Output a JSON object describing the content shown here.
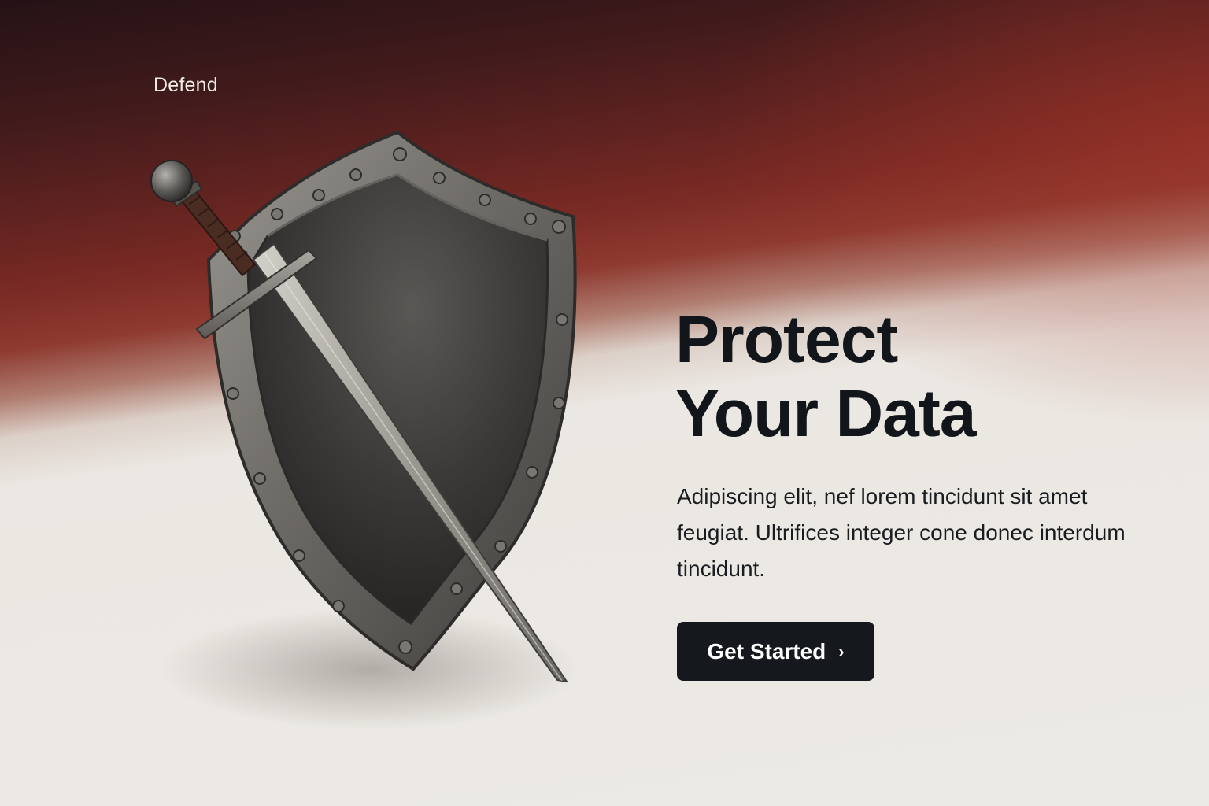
{
  "brand": {
    "name": "Defend"
  },
  "hero": {
    "title_line1": "Protect",
    "title_line2": "Your Data",
    "description": "Adipiscing elit, nef lorem tincidunt sit amet feugiat. Ultrifices integer cone donec interdum tincidunt.",
    "cta_label": "Get Started",
    "cta_icon": "chevron-right-icon"
  },
  "colors": {
    "header_dark": "#251216",
    "accent_red": "#8e3a30",
    "background": "#eceae5",
    "text_dark": "#12161a",
    "button_bg": "#15191d",
    "button_text": "#ffffff"
  },
  "illustration": {
    "icon": "shield-and-sword-icon"
  }
}
